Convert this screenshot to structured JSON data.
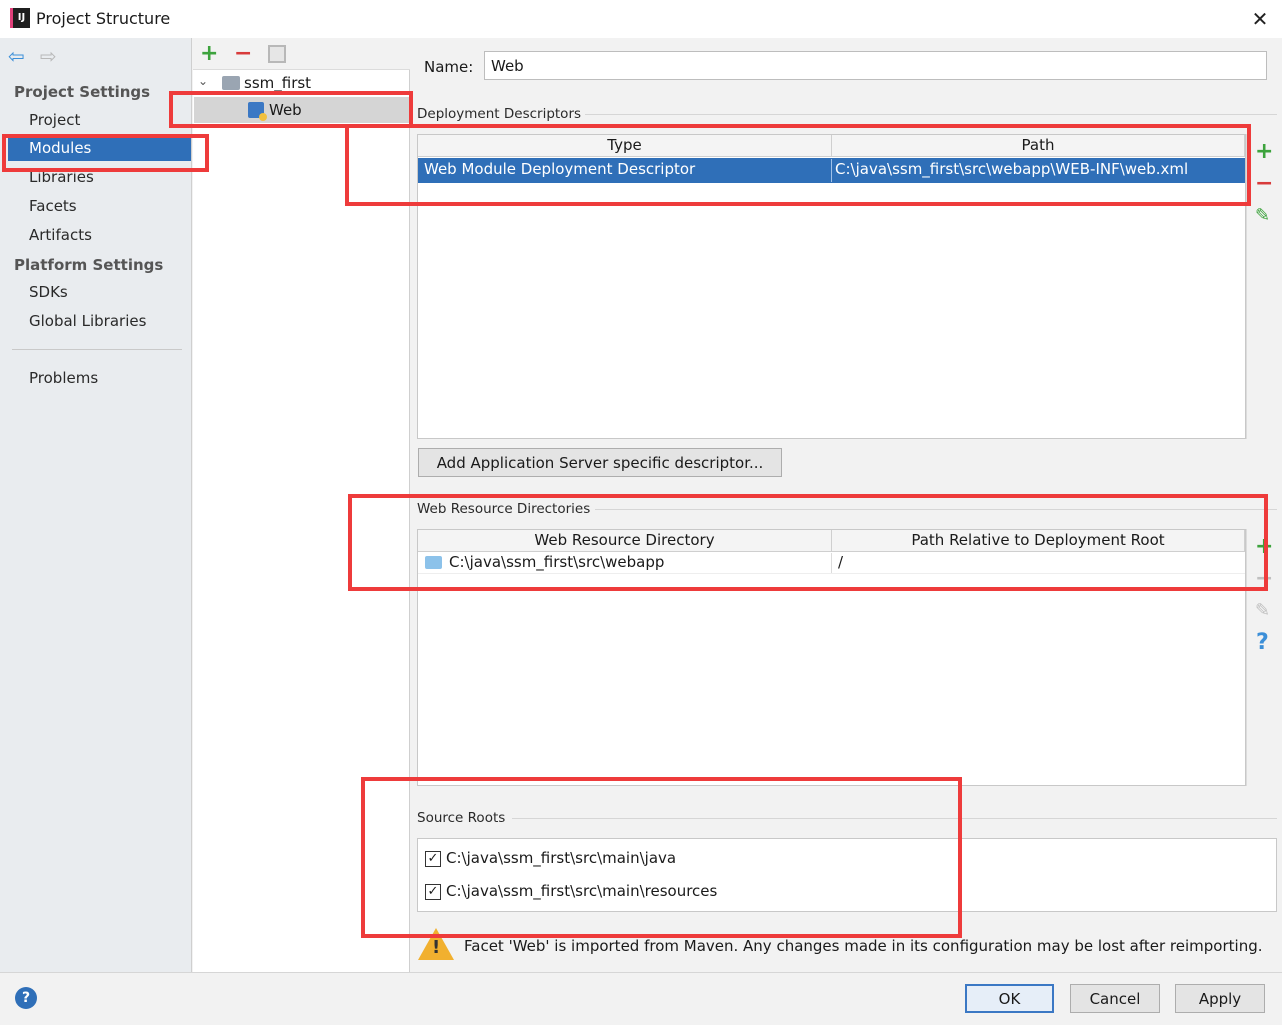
{
  "window": {
    "title": "Project Structure",
    "app_icon_text": "IJ",
    "close_glyph": "✕"
  },
  "sidebar": {
    "back_glyph": "⇦",
    "forward_glyph": "⇨",
    "project_settings_title": "Project Settings",
    "project_settings_items": [
      "Project",
      "Modules",
      "Libraries",
      "Facets",
      "Artifacts"
    ],
    "platform_settings_title": "Platform Settings",
    "platform_settings_items": [
      "SDKs",
      "Global Libraries"
    ],
    "problems_label": "Problems",
    "selected_item": "Modules"
  },
  "tree": {
    "add_glyph": "+",
    "remove_glyph": "−",
    "chevron_glyph": "⌄",
    "root_label": "ssm_first",
    "child_label": "Web"
  },
  "main": {
    "name_label": "Name:",
    "name_value": "Web",
    "deployment": {
      "title": "Deployment Descriptors",
      "columns": [
        "Type",
        "Path"
      ],
      "rows": [
        {
          "type": "Web Module Deployment Descriptor",
          "path": "C:\\java\\ssm_first\\src\\webapp\\WEB-INF\\web.xml"
        }
      ],
      "add_glyph": "+",
      "remove_glyph": "−",
      "edit_glyph": "✎",
      "add_server_button": "Add Application Server specific descriptor..."
    },
    "web_resources": {
      "title": "Web Resource Directories",
      "columns": [
        "Web Resource Directory",
        "Path Relative to Deployment Root"
      ],
      "rows": [
        {
          "directory": "C:\\java\\ssm_first\\src\\webapp",
          "relative_path": "/"
        }
      ],
      "add_glyph": "+",
      "remove_glyph": "−",
      "edit_glyph": "✎",
      "help_glyph": "?"
    },
    "source_roots": {
      "title": "Source Roots",
      "items": [
        {
          "path": "C:\\java\\ssm_first\\src\\main\\java",
          "checked": true
        },
        {
          "path": "C:\\java\\ssm_first\\src\\main\\resources",
          "checked": true
        }
      ],
      "check_glyph": "✓"
    },
    "warning_glyph": "!",
    "warning_text": "Facet 'Web' is imported from Maven. Any changes made in its configuration may be lost after reimporting."
  },
  "footer": {
    "help_glyph": "?",
    "ok_label": "OK",
    "cancel_label": "Cancel",
    "apply_label": "Apply"
  },
  "colors": {
    "selection": "#2f6fb8",
    "highlight_box": "#ee3b3b",
    "add_green": "#3da33d",
    "remove_red": "#d83b3b"
  }
}
